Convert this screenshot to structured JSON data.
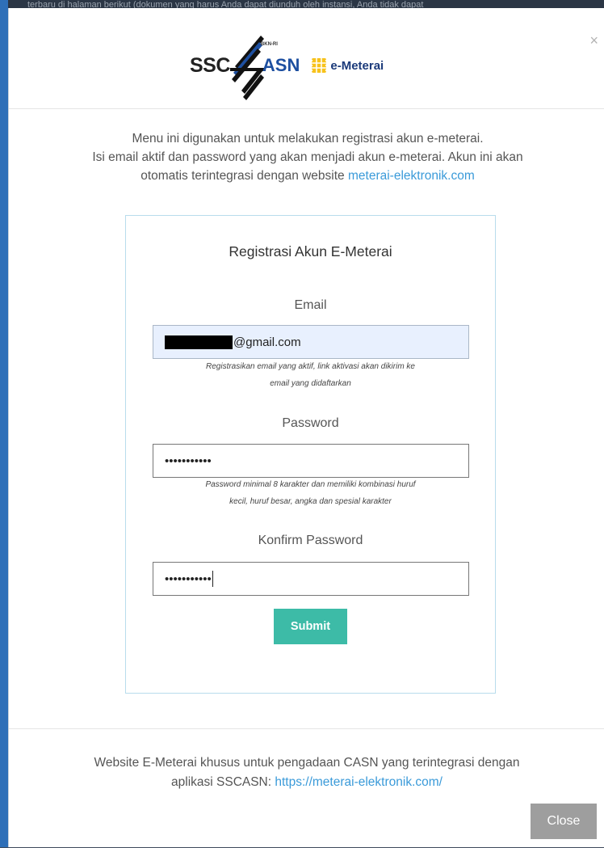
{
  "background": {
    "strip_text": "terbaru di halaman berikut (dokumen yang harus Anda dapat diunduh oleh instansi, Anda tidak dapat"
  },
  "modal": {
    "close_icon": "×",
    "logo": {
      "ssc": "SSC",
      "bkn": "BKN-RI",
      "asn": "ASN",
      "emeterai": "e-Meterai"
    },
    "intro": {
      "line1": "Menu ini digunakan untuk melakukan registrasi akun e-meterai.",
      "line2": "Isi email aktif dan password yang akan menjadi akun e-meterai. Akun ini akan",
      "line3_prefix": "otomatis terintegrasi dengan website ",
      "link": "meterai-elektronik.com"
    },
    "form": {
      "title": "Registrasi Akun E-Meterai",
      "email_label": "Email",
      "email_value_suffix": "@gmail.com",
      "email_help_1": "Registrasikan email yang aktif, link aktivasi akan dikirim ke",
      "email_help_2": "email yang didaftarkan",
      "password_label": "Password",
      "password_value": "•••••••••••",
      "password_help_1": "Password minimal 8 karakter dan memiliki kombinasi huruf",
      "password_help_2": "kecil, huruf besar, angka dan spesial karakter",
      "confirm_label": "Konfirm Password",
      "confirm_value": "•••••••••••",
      "submit_label": "Submit"
    },
    "footer": {
      "line1": "Website E-Meterai khusus untuk pengadaan CASN yang terintegrasi dengan",
      "line2_prefix": "aplikasi SSCASN: ",
      "link": "https://meterai-elektronik.com/",
      "close_label": "Close"
    }
  },
  "colors": {
    "accent_submit": "#3dbba7",
    "link": "#3a9ad9",
    "close_button": "#9e9e9e",
    "email_autofill_bg": "#e8f0fe"
  },
  "icons": [
    "close-icon",
    "ssc-asn-logo",
    "emeterai-logo"
  ]
}
